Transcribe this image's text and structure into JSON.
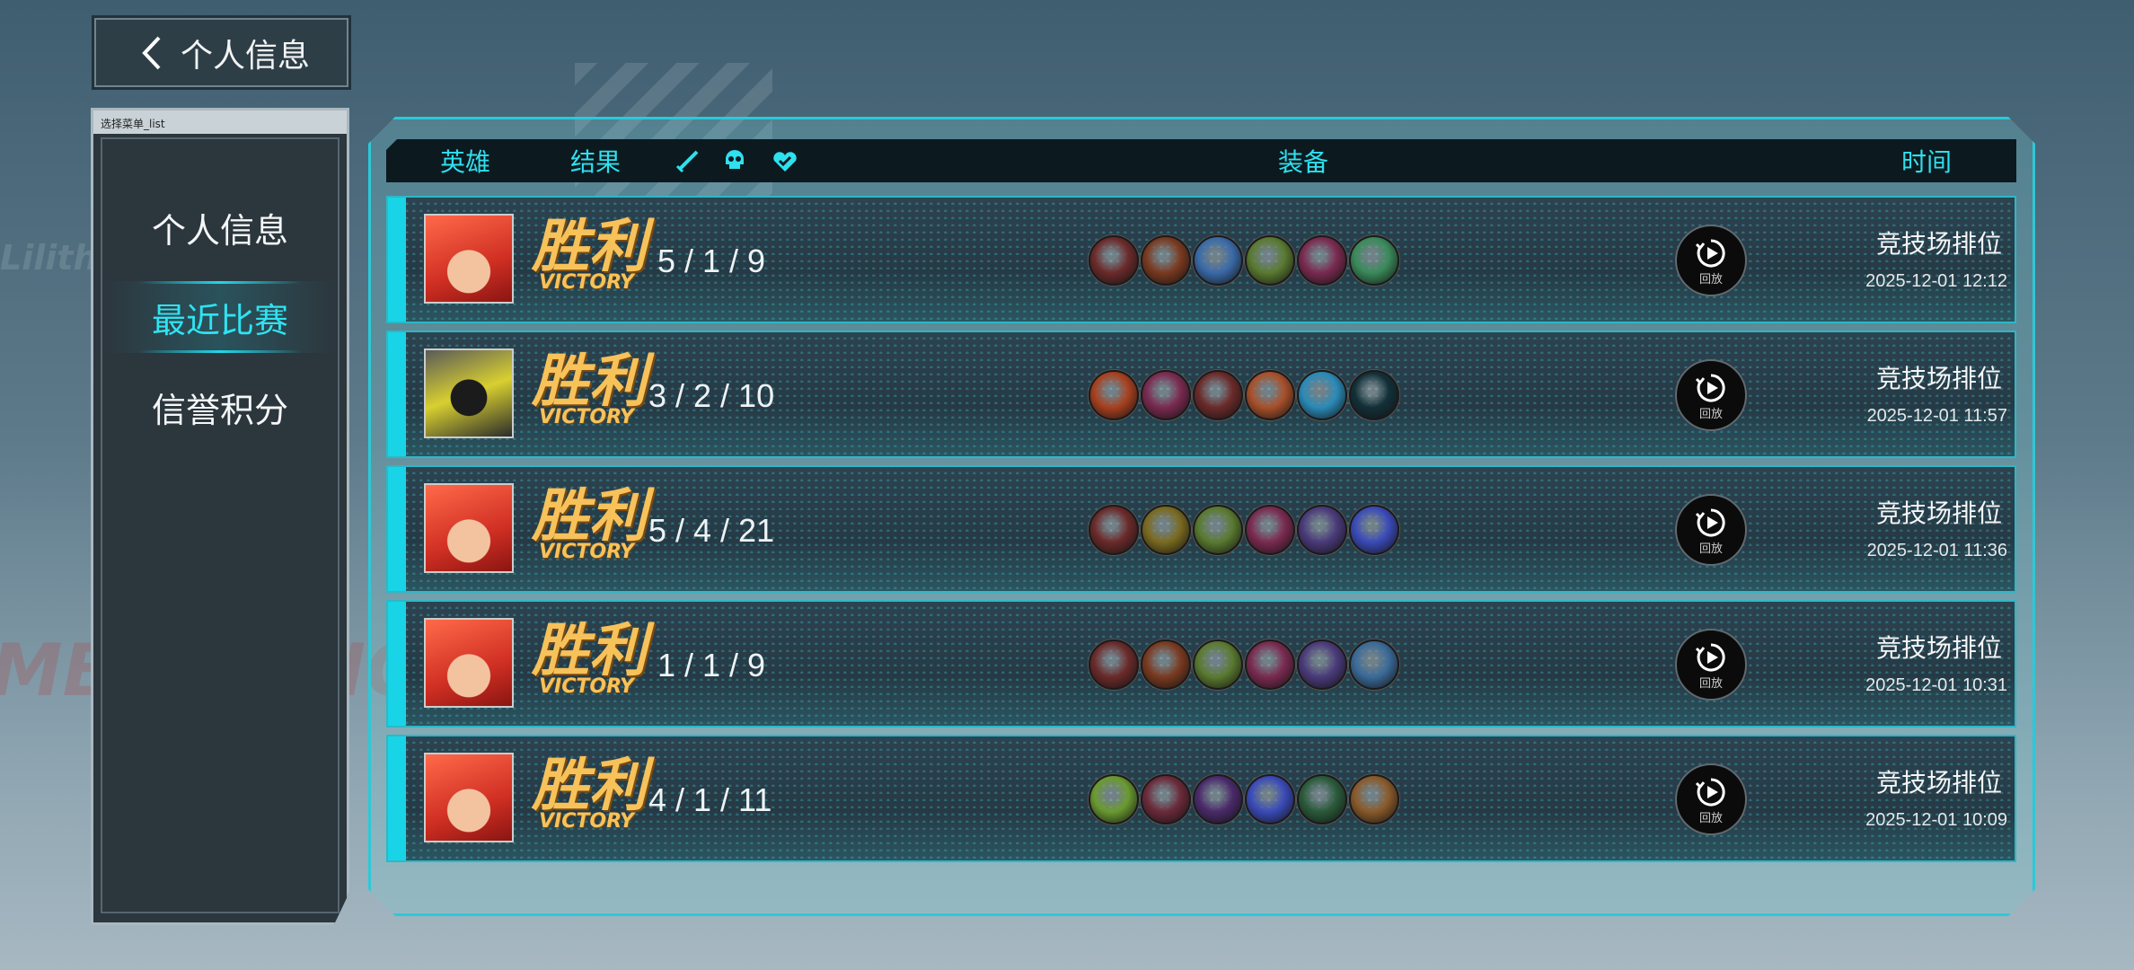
{
  "back": {
    "label": "个人信息"
  },
  "side": {
    "header": "选择菜单_list",
    "items": [
      {
        "label": "个人信息",
        "active": false
      },
      {
        "label": "最近比赛",
        "active": true
      },
      {
        "label": "信誉积分",
        "active": false
      }
    ]
  },
  "background": {
    "watermark1": "Lilith",
    "watermark2": "MBRACING"
  },
  "table": {
    "headers": {
      "hero": "英雄",
      "result": "结果",
      "equipment": "装备",
      "time": "时间"
    },
    "header_icons": [
      "sword-icon",
      "skull-icon",
      "assist-heart-icon"
    ],
    "rows": [
      {
        "avatar": "red-hair-hero",
        "result_zh": "胜利",
        "result_en": "VICTORY",
        "kda": "5 / 1 / 9",
        "items": [
          "#6b2a2a",
          "#7a3a20",
          "#3a6aa8",
          "#5a7a30",
          "#7a2a50",
          "#3a8a5a"
        ],
        "replay_label": "回放",
        "mode": "竞技场排位",
        "time": "2025-12-01 12:12"
      },
      {
        "avatar": "mech-hero",
        "result_zh": "胜利",
        "result_en": "VICTORY",
        "kda": "3 / 2 / 10",
        "items": [
          "#a8401f",
          "#7a2a50",
          "#6b2a2a",
          "#a8502a",
          "#2a8ab8",
          "#123038"
        ],
        "replay_label": "回放",
        "mode": "竞技场排位",
        "time": "2025-12-01 11:57"
      },
      {
        "avatar": "red-hair-hero",
        "result_zh": "胜利",
        "result_en": "VICTORY",
        "kda": "5 / 4 / 21",
        "items": [
          "#6b2a2a",
          "#7a6a20",
          "#5a7a30",
          "#7a2a50",
          "#4a3a7a",
          "#3a4ab8"
        ],
        "replay_label": "回放",
        "mode": "竞技场排位",
        "time": "2025-12-01 11:36"
      },
      {
        "avatar": "red-hair-hero",
        "result_zh": "胜利",
        "result_en": "VICTORY",
        "kda": "1 / 1 / 9",
        "items": [
          "#6b2a2a",
          "#7a3a20",
          "#5a7a30",
          "#7a2a50",
          "#4a3a7a",
          "#3a6a98"
        ],
        "replay_label": "回放",
        "mode": "竞技场排位",
        "time": "2025-12-01 10:31"
      },
      {
        "avatar": "red-hair-hero",
        "result_zh": "胜利",
        "result_en": "VICTORY",
        "kda": "4 / 1 / 11",
        "items": [
          "#6a9a30",
          "#6b2a3a",
          "#4a2a6a",
          "#3a4ab8",
          "#2a5a3a",
          "#8a5a2a"
        ],
        "replay_label": "回放",
        "mode": "竞技场排位",
        "time": "2025-12-01 10:09"
      }
    ]
  },
  "colors": {
    "accent": "#2fe0ee",
    "victory": "#f7c25a",
    "panel": "#2c363d"
  }
}
